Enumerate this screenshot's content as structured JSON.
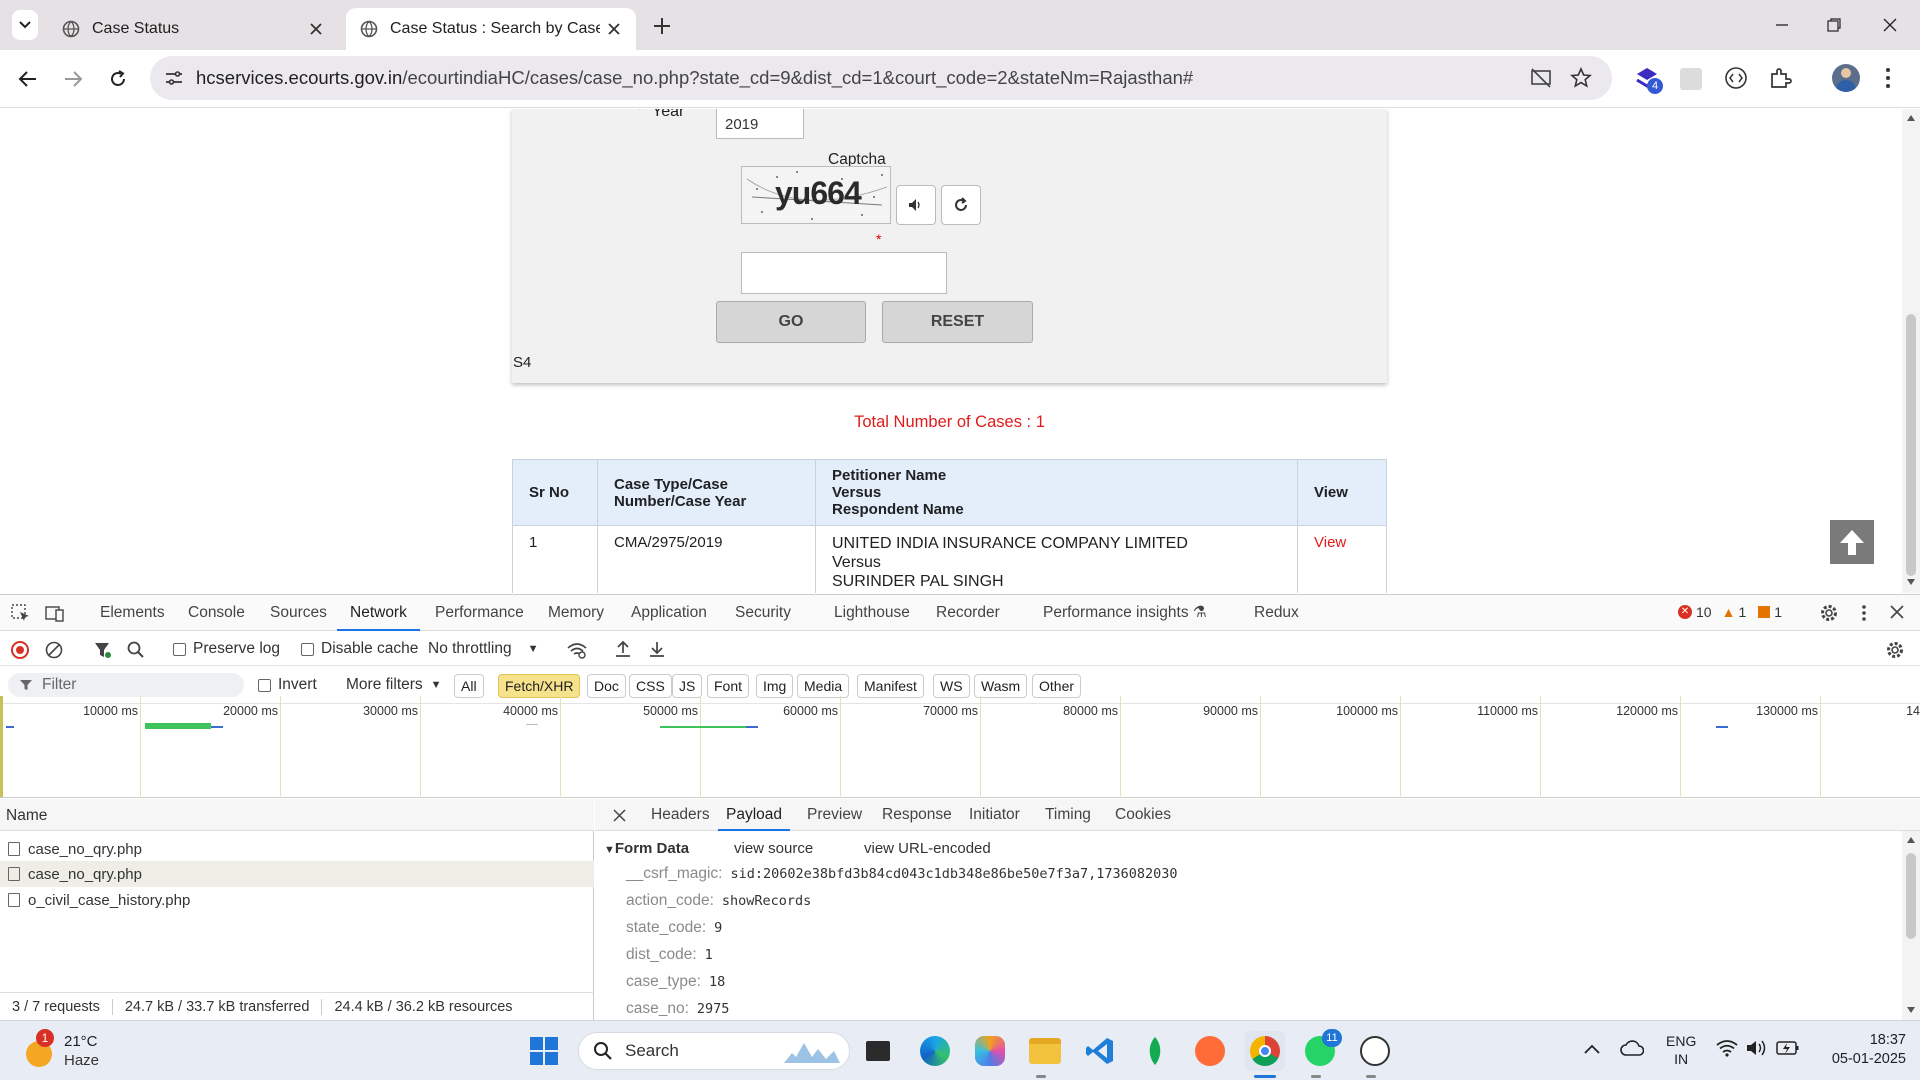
{
  "browser": {
    "tabs": [
      {
        "title": "Case Status"
      },
      {
        "title": "Case Status : Search by Case Nu"
      }
    ],
    "url": {
      "domain": "hcservices.ecourts.gov.in",
      "path": "/ecourtindiaHC/cases/case_no.php?state_cd=9&dist_cd=1&court_code=2&stateNm=Rajasthan#"
    },
    "extension_badge": "4"
  },
  "page": {
    "form": {
      "year_label": "Year",
      "year_value": "2019",
      "captcha_label": "Captcha",
      "captcha_text": "yu664",
      "required_star": "*",
      "go_label": "GO",
      "reset_label": "RESET",
      "footer_code": "S4"
    },
    "total_cases": "Total Number of Cases : 1",
    "table": {
      "headers": {
        "sr_no": "Sr No",
        "case_line1": "Case Type/Case",
        "case_line2": "Number/Case Year",
        "party_line1": "Petitioner Name",
        "party_line2": "Versus",
        "party_line3": "Respondent Name",
        "view": "View"
      },
      "rows": [
        {
          "sr_no": "1",
          "case": "CMA/2975/2019",
          "petitioner": "UNITED INDIA INSURANCE COMPANY LIMITED",
          "versus": "Versus",
          "respondent": "SURINDER PAL SINGH",
          "view": "View"
        }
      ]
    }
  },
  "devtools": {
    "tabs": [
      "Elements",
      "Console",
      "Sources",
      "Network",
      "Performance",
      "Memory",
      "Application",
      "Security",
      "Lighthouse",
      "Recorder",
      "Performance insights",
      "Redux"
    ],
    "active_tab": "Network",
    "counts": {
      "errors": "10",
      "warnings": "1",
      "issues": "1"
    },
    "toolbar": {
      "preserve_log": "Preserve log",
      "disable_cache": "Disable cache",
      "throttling": "No throttling"
    },
    "filter": {
      "placeholder": "Filter",
      "invert": "Invert",
      "more_filters": "More filters",
      "chips": [
        "All",
        "Fetch/XHR",
        "Doc",
        "CSS",
        "JS",
        "Font",
        "Img",
        "Media",
        "Manifest",
        "WS",
        "Wasm",
        "Other"
      ],
      "active_chip": "Fetch/XHR"
    },
    "timeline_ticks": [
      "10000 ms",
      "20000 ms",
      "30000 ms",
      "40000 ms",
      "50000 ms",
      "60000 ms",
      "70000 ms",
      "80000 ms",
      "90000 ms",
      "100000 ms",
      "110000 ms",
      "120000 ms",
      "130000 ms",
      "14"
    ],
    "requests_header": "Name",
    "requests": [
      "case_no_qry.php",
      "case_no_qry.php",
      "o_civil_case_history.php"
    ],
    "status_bar": {
      "requests": "3 / 7 requests",
      "transferred": "24.7 kB / 33.7 kB transferred",
      "resources": "24.4 kB / 36.2 kB resources"
    },
    "detail_tabs": [
      "Headers",
      "Payload",
      "Preview",
      "Response",
      "Initiator",
      "Timing",
      "Cookies"
    ],
    "active_detail_tab": "Payload",
    "form_data": {
      "title": "Form Data",
      "view_source": "view source",
      "view_url_encoded": "view URL-encoded",
      "fields": [
        {
          "key": "__csrf_magic:",
          "value": "sid:20602e38bfd3b84cd043c1db348e86be50e7f3a7,1736082030"
        },
        {
          "key": "action_code:",
          "value": "showRecords"
        },
        {
          "key": "state_code:",
          "value": "9"
        },
        {
          "key": "dist_code:",
          "value": "1"
        },
        {
          "key": "case_type:",
          "value": "18"
        },
        {
          "key": "case_no:",
          "value": "2975"
        }
      ]
    }
  },
  "taskbar": {
    "weather": {
      "temp": "21°C",
      "condition": "Haze",
      "badge": "1"
    },
    "search_label": "Search",
    "whatsapp_badge": "11",
    "lang": {
      "line1": "ENG",
      "line2": "IN"
    },
    "clock": {
      "time": "18:37",
      "date": "05-01-2025"
    }
  }
}
